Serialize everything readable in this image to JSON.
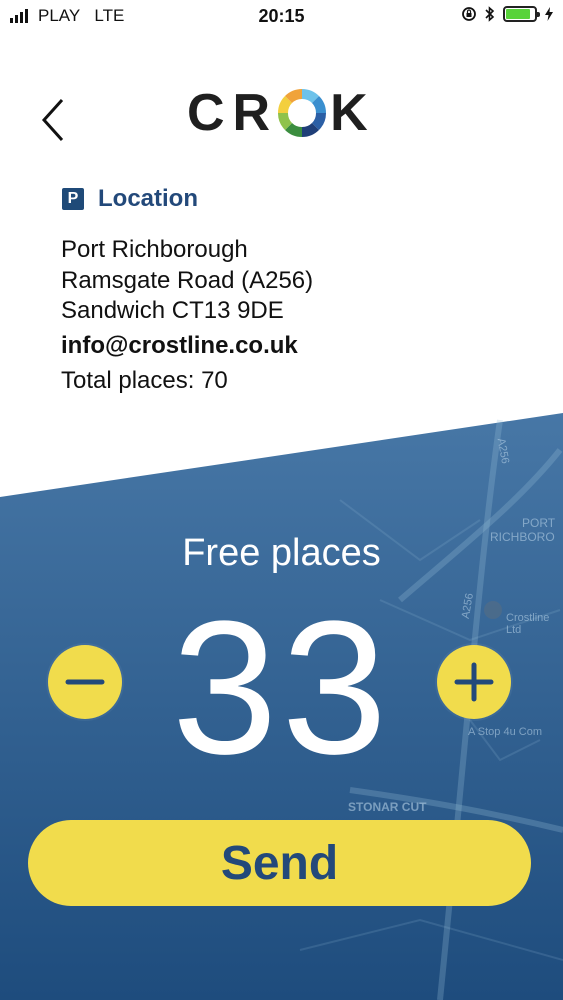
{
  "status_bar": {
    "carrier": "PLAY",
    "network": "LTE",
    "time": "20:15",
    "battery_level": 0.85
  },
  "header": {
    "logo_text_start": "CR",
    "logo_text_end": "K",
    "back_icon": "chevron-left-icon"
  },
  "location": {
    "badge": "P",
    "title": "Location",
    "address_lines": [
      "Port Richborough",
      "Ramsgate Road (A256)",
      "Sandwich CT13 9DE"
    ],
    "email": "info@crostline.co.uk",
    "total_places": "Total places: 70"
  },
  "counter": {
    "label": "Free places",
    "value": "33"
  },
  "actions": {
    "send_label": "Send",
    "decrement_icon": "minus-icon",
    "increment_icon": "plus-icon"
  },
  "map_labels": [
    "PORT",
    "RICHBORO",
    "A256",
    "A256",
    "Crostline Ltd",
    "A Stop 4u Com",
    "STONAR CUT"
  ],
  "colors": {
    "accent_yellow": "#f1dc4c",
    "brand_blue": "#23497a",
    "panel_top": "#3d6f9e",
    "panel_bottom": "#1f4e7f"
  }
}
